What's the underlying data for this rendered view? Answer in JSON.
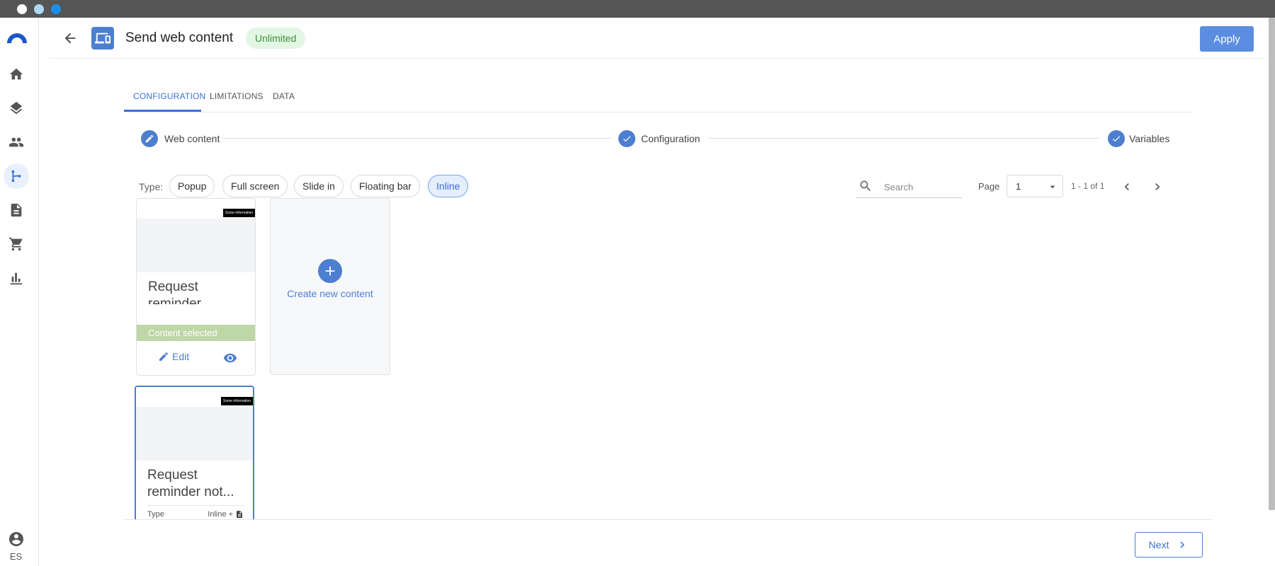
{
  "header": {
    "title": "Send web content",
    "badge": "Unlimited",
    "apply_label": "Apply"
  },
  "sidebar": {
    "items": [
      {
        "name": "home-icon"
      },
      {
        "name": "layers-icon"
      },
      {
        "name": "users-icon"
      },
      {
        "name": "flow-icon",
        "active": true
      },
      {
        "name": "document-icon"
      },
      {
        "name": "cart-icon"
      },
      {
        "name": "chart-icon"
      }
    ],
    "language": "ES"
  },
  "tabs": [
    {
      "label": "CONFIGURATION",
      "active": true
    },
    {
      "label": "LIMITATIONS"
    },
    {
      "label": "DATA"
    }
  ],
  "stepper": [
    {
      "label": "Web content",
      "icon": "pencil-icon"
    },
    {
      "label": "Configuration",
      "icon": "check-icon"
    },
    {
      "label": "Variables",
      "icon": "check-icon"
    }
  ],
  "filters": {
    "type_label": "Type:",
    "chips": [
      {
        "label": "Popup"
      },
      {
        "label": "Full screen"
      },
      {
        "label": "Slide in"
      },
      {
        "label": "Floating bar"
      },
      {
        "label": "Inline",
        "selected": true
      }
    ]
  },
  "pagination": {
    "search_placeholder": "Search",
    "page_label": "Page",
    "page_value": "1",
    "range": "1 - 1 of 1"
  },
  "cards": [
    {
      "title": "Request reminder",
      "status": "Content selected",
      "edit_label": "Edit",
      "thumb_text": "Some information"
    },
    {
      "title": "Request reminder not...",
      "meta_label": "Type",
      "meta_value": "Inline",
      "thumb_text": "Some information"
    }
  ],
  "create_card": {
    "label": "Create new content"
  },
  "footer": {
    "next_label": "Next"
  },
  "colors": {
    "accent": "#4d7fd0",
    "badge_bg": "#e3f6e3",
    "badge_text": "#3a8f3a",
    "selected_bar": "#bfd6a6"
  }
}
